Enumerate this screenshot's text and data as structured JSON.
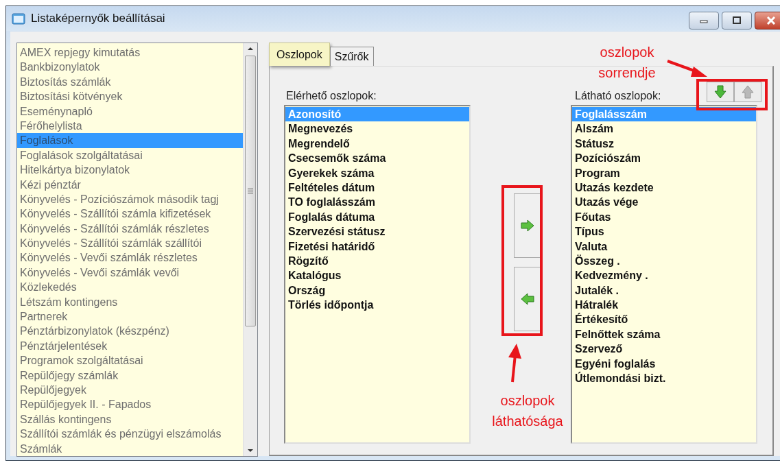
{
  "window": {
    "title": "Listaképernyők beállításai"
  },
  "report_list": {
    "items": [
      {
        "label": "AMEX repjegy kimutatás",
        "selected": false
      },
      {
        "label": "Bankbizonylatok",
        "selected": false
      },
      {
        "label": "Biztosítás számlák",
        "selected": false
      },
      {
        "label": "Biztosítási kötvények",
        "selected": false
      },
      {
        "label": "Eseménynapló",
        "selected": false
      },
      {
        "label": "Férőhelylista",
        "selected": false
      },
      {
        "label": "Foglalások",
        "selected": true
      },
      {
        "label": "Foglalások szolgáltatásai",
        "selected": false
      },
      {
        "label": "Hitelkártya bizonylatok",
        "selected": false
      },
      {
        "label": "Kézi pénztár",
        "selected": false
      },
      {
        "label": "Könyvelés - Pozíciószámok második tagj",
        "selected": false
      },
      {
        "label": "Könyvelés - Szállítói számla kifizetések",
        "selected": false
      },
      {
        "label": "Könyvelés - Szállítói számlák részletes",
        "selected": false
      },
      {
        "label": "Könyvelés - Szállítói számlák szállítói",
        "selected": false
      },
      {
        "label": "Könyvelés - Vevői számlák részletes",
        "selected": false
      },
      {
        "label": "Könyvelés - Vevői számlák vevői",
        "selected": false
      },
      {
        "label": "Közlekedés",
        "selected": false
      },
      {
        "label": "Létszám kontingens",
        "selected": false
      },
      {
        "label": "Partnerek",
        "selected": false
      },
      {
        "label": "Pénztárbizonylatok (készpénz)",
        "selected": false
      },
      {
        "label": "Pénztárjelentések",
        "selected": false
      },
      {
        "label": "Programok szolgáltatásai",
        "selected": false
      },
      {
        "label": "Repülőjegy számlák",
        "selected": false
      },
      {
        "label": "Repülőjegyek",
        "selected": false
      },
      {
        "label": "Repülőjegyek II. - Fapados",
        "selected": false
      },
      {
        "label": "Szállás kontingens",
        "selected": false
      },
      {
        "label": "Szállítói számlák és pénzügyi elszámolás",
        "selected": false
      },
      {
        "label": "Számlák",
        "selected": false
      }
    ]
  },
  "tabs": [
    {
      "label": "Oszlopok",
      "selected": true
    },
    {
      "label": "Szűrők",
      "selected": false
    }
  ],
  "available_columns": {
    "label": "Elérhető oszlopok:",
    "items": [
      {
        "label": "Azonosító",
        "selected": true
      },
      {
        "label": "Megnevezés",
        "selected": false
      },
      {
        "label": "Megrendelő",
        "selected": false
      },
      {
        "label": "Csecsemők száma",
        "selected": false
      },
      {
        "label": "Gyerekek száma",
        "selected": false
      },
      {
        "label": "Feltételes dátum",
        "selected": false
      },
      {
        "label": "TO foglalásszám",
        "selected": false
      },
      {
        "label": "Foglalás dátuma",
        "selected": false
      },
      {
        "label": "Szervezési státusz",
        "selected": false
      },
      {
        "label": "Fizetési határidő",
        "selected": false
      },
      {
        "label": "Rögzítő",
        "selected": false
      },
      {
        "label": "Katalógus",
        "selected": false
      },
      {
        "label": "Ország",
        "selected": false
      },
      {
        "label": "Törlés időpontja",
        "selected": false
      }
    ]
  },
  "visible_columns": {
    "label": "Látható oszlopok:",
    "items": [
      {
        "label": "Foglalásszám",
        "selected": true
      },
      {
        "label": "Alszám",
        "selected": false
      },
      {
        "label": "Státusz",
        "selected": false
      },
      {
        "label": "Pozíciószám",
        "selected": false
      },
      {
        "label": "Program",
        "selected": false
      },
      {
        "label": "Utazás kezdete",
        "selected": false
      },
      {
        "label": "Utazás vége",
        "selected": false
      },
      {
        "label": "Főutas",
        "selected": false
      },
      {
        "label": "Típus",
        "selected": false
      },
      {
        "label": "Valuta",
        "selected": false
      },
      {
        "label": "Összeg .",
        "selected": false
      },
      {
        "label": "Kedvezmény .",
        "selected": false
      },
      {
        "label": "Jutalék .",
        "selected": false
      },
      {
        "label": "Hátralék",
        "selected": false
      },
      {
        "label": "Értékesítő",
        "selected": false
      },
      {
        "label": "Felnőttek száma",
        "selected": false
      },
      {
        "label": "Szervező",
        "selected": false
      },
      {
        "label": "Egyéni foglalás",
        "selected": false
      },
      {
        "label": "Útlemondási bizt.",
        "selected": false
      }
    ]
  },
  "order_buttons": [
    {
      "kind": "down",
      "disabled": false
    },
    {
      "kind": "up",
      "disabled": true
    }
  ],
  "annotations": [
    {
      "text": "oszlopok sorrendje"
    },
    {
      "text": "oszlopok láthatósága"
    }
  ]
}
